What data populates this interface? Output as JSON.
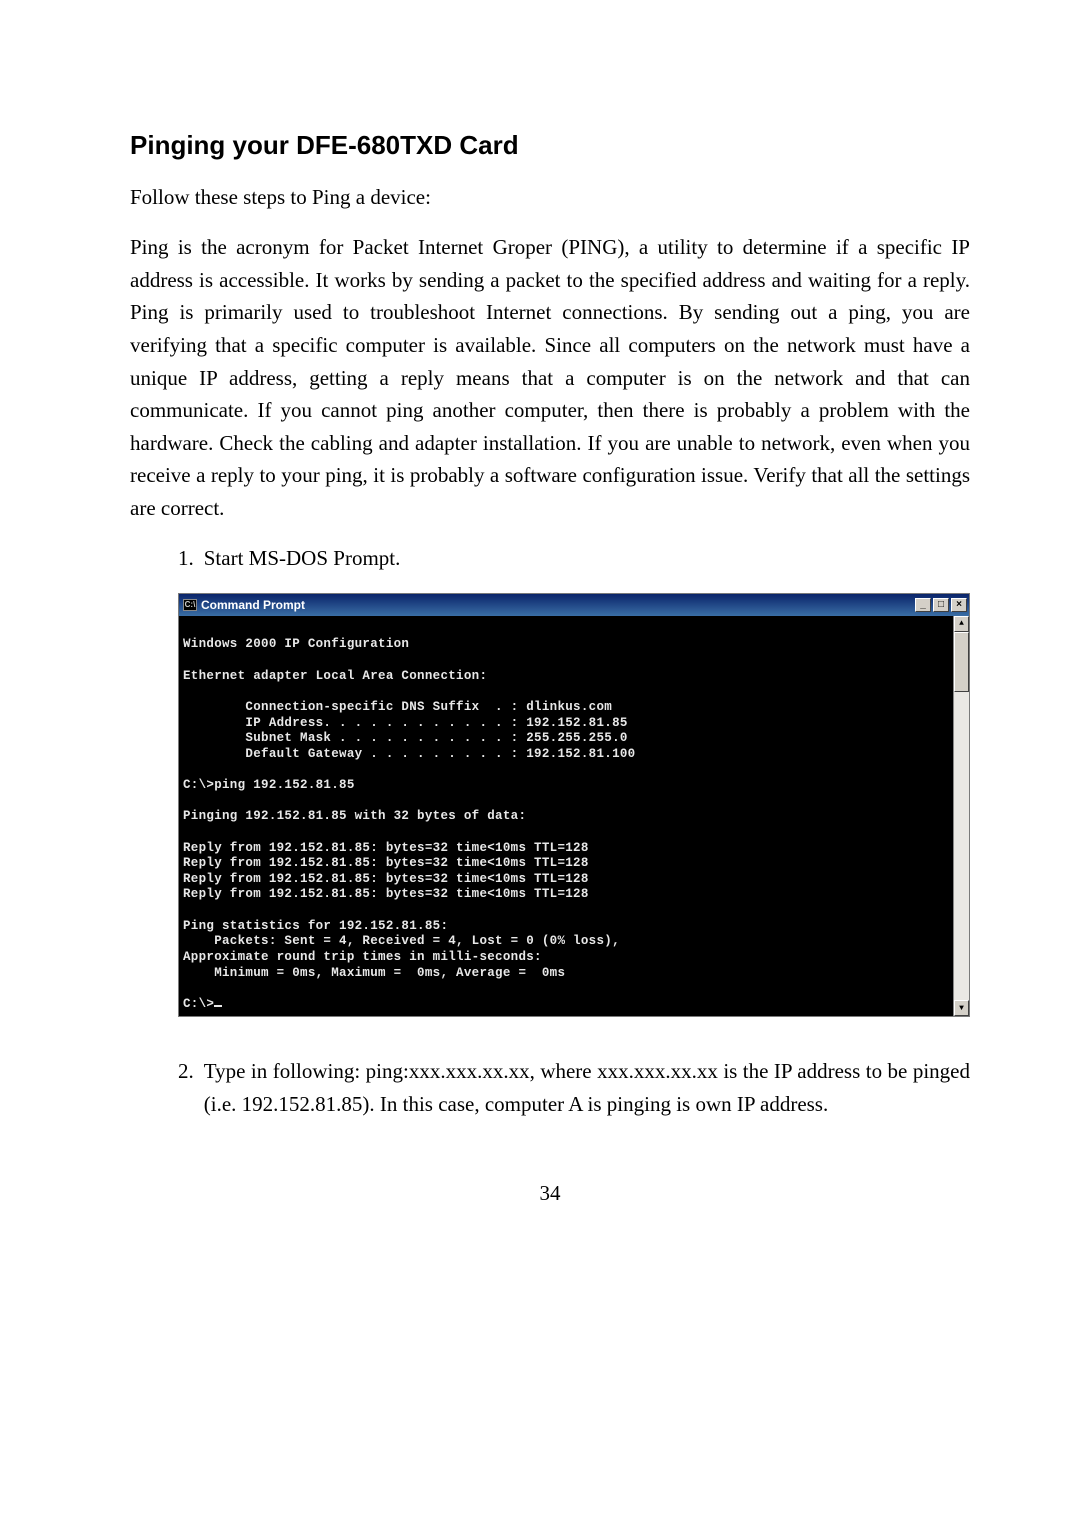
{
  "heading": "Pinging your DFE-680TXD Card",
  "intro": "Follow these steps to Ping a device:",
  "body": "Ping is the acronym for Packet Internet Groper (PING), a utility to determine if a specific IP address is accessible. It works by sending a packet to the specified address and waiting for a reply. Ping is primarily used to troubleshoot Internet connections. By sending out a ping, you are verifying that a specific computer is available. Since all computers on the network must have a unique IP address, getting a reply means that a computer is on the network and that can communicate. If you cannot ping another computer, then there is probably a problem with the hardware. Check the cabling and adapter installation. If you are unable to network, even when you receive a reply to your ping, it is probably a software configuration issue. Verify that all the settings are correct.",
  "step1": {
    "num": "1.",
    "text": "Start MS-DOS Prompt."
  },
  "terminal": {
    "title": "Command Prompt",
    "icon_label": "C:\\",
    "lines": [
      "",
      "Windows 2000 IP Configuration",
      "",
      "Ethernet adapter Local Area Connection:",
      "",
      "        Connection-specific DNS Suffix  . : dlinkus.com",
      "        IP Address. . . . . . . . . . . . : 192.152.81.85",
      "        Subnet Mask . . . . . . . . . . . : 255.255.255.0",
      "        Default Gateway . . . . . . . . . : 192.152.81.100",
      "",
      "C:\\>ping 192.152.81.85",
      "",
      "Pinging 192.152.81.85 with 32 bytes of data:",
      "",
      "Reply from 192.152.81.85: bytes=32 time<10ms TTL=128",
      "Reply from 192.152.81.85: bytes=32 time<10ms TTL=128",
      "Reply from 192.152.81.85: bytes=32 time<10ms TTL=128",
      "Reply from 192.152.81.85: bytes=32 time<10ms TTL=128",
      "",
      "Ping statistics for 192.152.81.85:",
      "    Packets: Sent = 4, Received = 4, Lost = 0 (0% loss),",
      "Approximate round trip times in milli-seconds:",
      "    Minimum = 0ms, Maximum =  0ms, Average =  0ms",
      "",
      "C:\\>"
    ],
    "buttons": {
      "minimize": "_",
      "maximize": "□",
      "close": "×"
    },
    "scroll": {
      "up": "▲",
      "down": "▼"
    }
  },
  "step2": {
    "num": "2.",
    "text": "Type in following: ping:xxx.xxx.xx.xx, where xxx.xxx.xx.xx is the IP address to be pinged (i.e. 192.152.81.85). In this case, computer A is pinging is own IP address."
  },
  "page_num": "34"
}
